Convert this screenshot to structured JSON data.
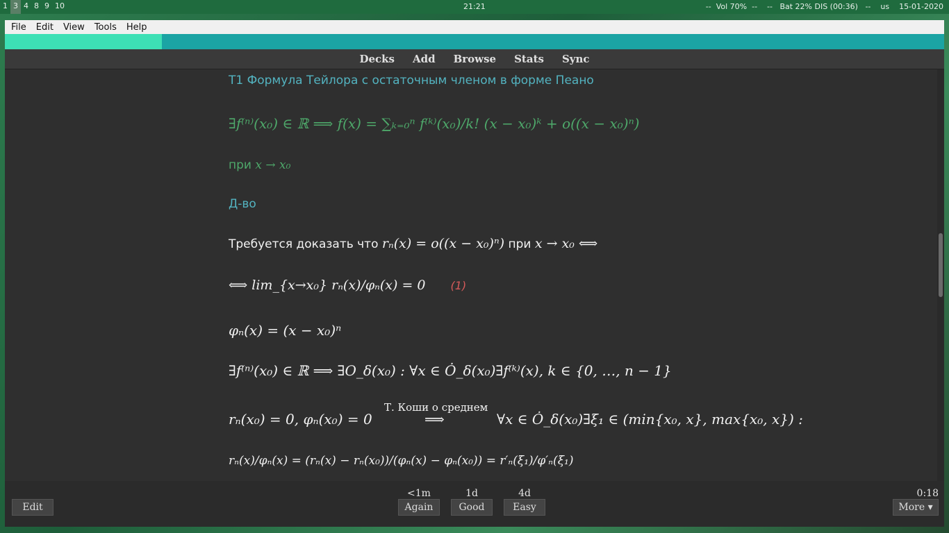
{
  "topbar": {
    "workspaces": [
      "1",
      "3",
      "4",
      "8",
      "9",
      "10"
    ],
    "active_workspace": "3",
    "clock": "21:21",
    "sysinfo": "--  Vol 70%  --    --   Bat 22% DIS (00:36)   --    us    15-01-2020"
  },
  "menubar": {
    "items": [
      "File",
      "Edit",
      "View",
      "Tools",
      "Help"
    ]
  },
  "progress": {
    "fraction": 0.167
  },
  "toolbar": {
    "items": [
      "Decks",
      "Add",
      "Browse",
      "Stats",
      "Sync"
    ]
  },
  "card": {
    "title": "T1 Формула Тейлора с остаточным членом в форме Пеано",
    "formula_main": "∃f⁽ⁿ⁾(x₀) ∈ ℝ ⟹ f(x) = ∑ₖ₌₀ⁿ f⁽ᵏ⁾(x₀)/k! (x − x₀)ᵏ + o((x − x₀)ⁿ)",
    "condition_prefix": "при",
    "condition_math": "x → x₀",
    "proof_label": "Д-во",
    "require_prefix": "Требуется доказать что",
    "require_math": "rₙ(x) = o((x − x₀)ⁿ)",
    "require_mid": "при",
    "require_math2": "x → x₀ ⟺",
    "limit_line": "⟺ lim_{x→x₀} rₙ(x)/φₙ(x) = 0",
    "limit_tag": "(1)",
    "phi_def": "φₙ(x) = (x − x₀)ⁿ",
    "exists_line": "∃f⁽ⁿ⁾(x₀) ∈ ℝ ⟹ ∃O_δ(x₀) : ∀x ∈ Ȯ_δ(x₀)∃f⁽ᵏ⁾(x), k ∈ {0, …, n − 1}",
    "cauchy_over": "Т. Коши о среднем",
    "cauchy_left": "rₙ(x₀) = 0, φₙ(x₀) = 0",
    "cauchy_arrow": "⟹",
    "cauchy_right": "∀x ∈ Ȯ_δ(x₀)∃ξ₁ ∈ (min{x₀, x}, max{x₀, x}) :",
    "ratio_line": "rₙ(x)/φₙ(x) = (rₙ(x) − rₙ(x₀))/(φₙ(x) − φₙ(x₀)) = r′ₙ(ξ₁)/φ′ₙ(ξ₁)"
  },
  "bottom": {
    "edit": "Edit",
    "answers": [
      {
        "time": "<1m",
        "label": "Again"
      },
      {
        "time": "1d",
        "label": "Good"
      },
      {
        "time": "4d",
        "label": "Easy"
      }
    ],
    "timer": "0:18",
    "more": "More ▾"
  }
}
